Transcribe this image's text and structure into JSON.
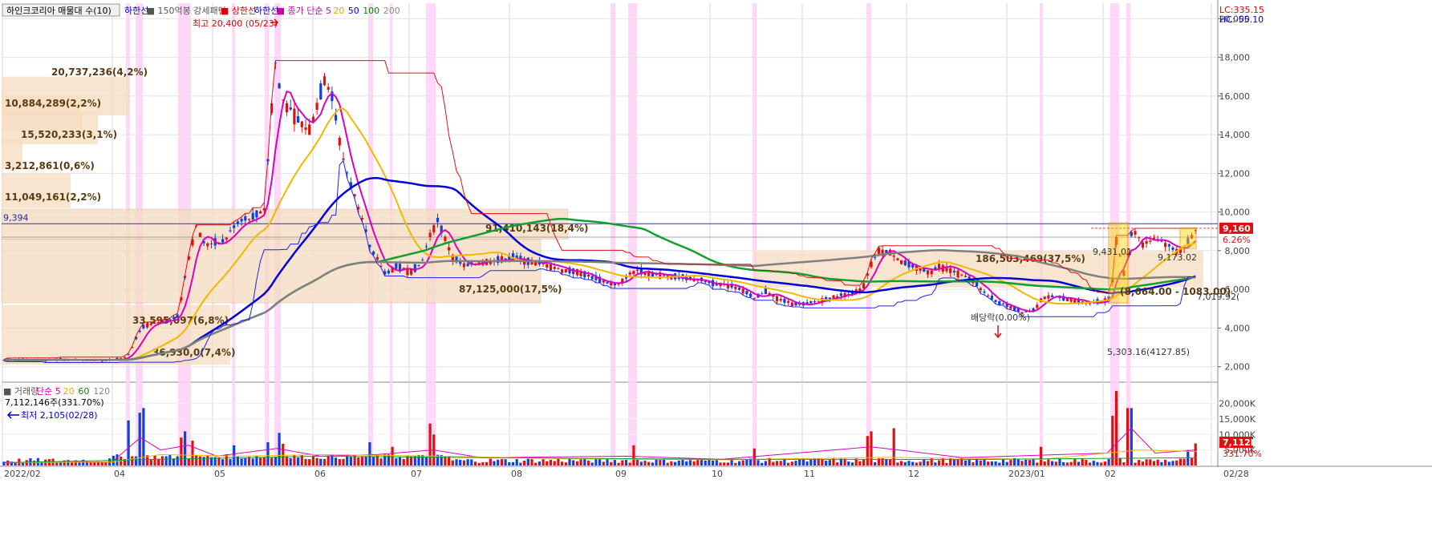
{
  "header": {
    "title_box": "하인크코리아 매물대 수(10)",
    "items": [
      {
        "text": "하한선",
        "color": "#0000cc"
      },
      {
        "text": "■ 150억봉 강세패턴",
        "color": "#555555"
      },
      {
        "text": "■ 상한선",
        "color": "#dd0000"
      },
      {
        "text": "하한선",
        "color": "#0000cc"
      },
      {
        "text": "■ 종가 단순 5",
        "color": "#cc00aa"
      },
      {
        "text": "20",
        "color": "#e6a700"
      },
      {
        "text": "50",
        "color": "#0000cc"
      },
      {
        "text": "100",
        "color": "#008800"
      },
      {
        "text": "200",
        "color": "#888888"
      }
    ],
    "max_label": "최고 20,400 (05/23)",
    "min_label": "최저 2,105(02/28)",
    "lc_label": "LC:335.15",
    "hc_label": "HC:-55.10"
  },
  "volume_header": {
    "items": [
      {
        "text": "■ 거래량",
        "color": "#555555"
      },
      {
        "text": "단순 5",
        "color": "#cc00aa"
      },
      {
        "text": "20",
        "color": "#e6a700"
      },
      {
        "text": "60",
        "color": "#008800"
      },
      {
        "text": "120",
        "color": "#888888"
      }
    ],
    "current": "7,112,146주(331.70%)"
  },
  "price_axis": {
    "min": 1200,
    "max": 20800,
    "ticks": [
      2000,
      4000,
      6000,
      8000,
      10000,
      12000,
      14000,
      16000,
      18000,
      20000
    ],
    "tick_labels": [
      "2,000",
      "4,000",
      "6,000",
      "8,000",
      "10,000",
      "12,000",
      "14,000",
      "16,000",
      "18,000",
      "20,000"
    ]
  },
  "volume_axis": {
    "max": 24000,
    "ticks": [
      5000,
      10000,
      15000,
      20000
    ],
    "tick_labels": [
      "5,000K",
      "10,000K",
      "15,000K",
      "20,000K"
    ]
  },
  "time_axis": {
    "labels": [
      "2022/02",
      "04",
      "05",
      "06",
      "07",
      "08",
      "09",
      "10",
      "11",
      "12",
      "2023/01",
      "02",
      "02/28"
    ]
  },
  "current_price": {
    "value": 9160,
    "label": "9,160",
    "pct": "6.26%"
  },
  "current_volume": {
    "label": "7,112K",
    "pct": "331.70%"
  },
  "hline": {
    "value": 9394,
    "label": "9,394"
  },
  "chart_data": {
    "type": "candlestick",
    "volume_profile": [
      {
        "low": 8600,
        "high": 10150,
        "label": "91,410,143(18,4%)"
      },
      {
        "low": 5300,
        "high": 8600,
        "label": "87,125,000(17,5%)"
      },
      {
        "low": 6100,
        "high": 8000,
        "label": "186,503,469(37,5%)"
      },
      {
        "low": 3600,
        "high": 5200,
        "label": "33,595,097(6,8%)"
      },
      {
        "low": 2100,
        "high": 3600,
        "label": "36,930,0(7,4%)"
      },
      {
        "low": 15000,
        "high": 17000,
        "label": "20,737,236(4,2%)"
      },
      {
        "low": 14200,
        "high": 16000,
        "label": "10,884,289(2,2%)"
      },
      {
        "low": 13500,
        "high": 15200,
        "label": "15,520,233(3,1%)"
      },
      {
        "low": 12200,
        "high": 13800,
        "label": "3,212,861(0,6%)"
      },
      {
        "low": 10200,
        "high": 12000,
        "label": "11,049,161(2,2%)"
      }
    ],
    "annotations": [
      {
        "text": "9,431.01"
      },
      {
        "text": "9,173.02"
      },
      {
        "text": "7,019.92("
      },
      {
        "text": "5,303.16(4127.85)"
      },
      {
        "text": "배당락(0.00%)"
      },
      {
        "text": "(8,664.00 - 1083.00)"
      }
    ],
    "series_notes": "Daily candles Feb 2022 - Feb 2023 with MA 5/20/50/100/200, upper/lower channel lines"
  }
}
